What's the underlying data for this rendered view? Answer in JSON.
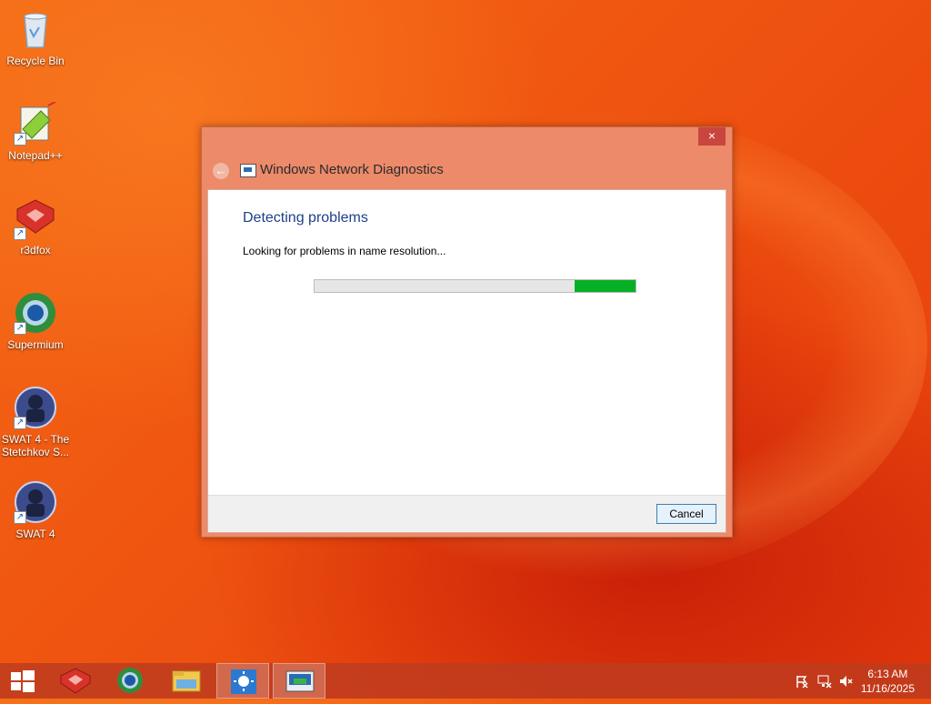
{
  "desktop": {
    "icons": [
      {
        "label": "Recycle Bin"
      },
      {
        "label": "Notepad++"
      },
      {
        "label": "r3dfox"
      },
      {
        "label": "Supermium"
      },
      {
        "label": "SWAT 4 - The Stetchkov S..."
      },
      {
        "label": "SWAT 4"
      }
    ]
  },
  "dialog": {
    "title": "Windows Network Diagnostics",
    "close_label": "×",
    "back_label": "←",
    "heading": "Detecting problems",
    "status": "Looking for problems in name resolution...",
    "progress": {
      "fill_start_percent": 81,
      "fill_end_percent": 100,
      "color": "#06b025"
    },
    "cancel_label": "Cancel"
  },
  "taskbar": {
    "buttons": [
      "start-button",
      "r3dfox",
      "supermium",
      "file-explorer",
      "brightness-app",
      "network-diagnostics"
    ],
    "active_button": "network-diagnostics",
    "clock": {
      "time": "6:13 AM",
      "date": "11/16/2025"
    }
  },
  "colors": {
    "accent": "#ec8a6a",
    "heading": "#1e3f8a",
    "progress": "#06b025"
  }
}
